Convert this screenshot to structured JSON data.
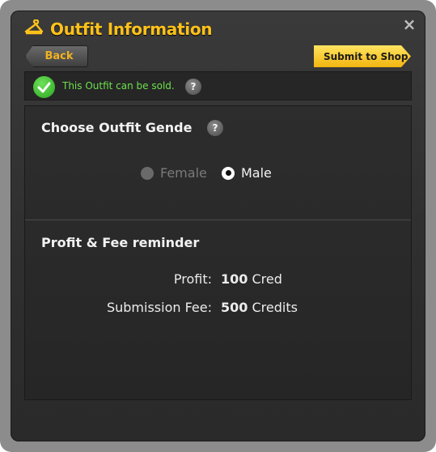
{
  "window": {
    "title": "Outfit Information",
    "close_label": "×"
  },
  "toolbar": {
    "back_label": "Back",
    "submit_label": "Submit to Shop"
  },
  "status": {
    "message": "This Outfit can be sold.",
    "help_label": "?"
  },
  "gender": {
    "title": "Choose Outfit Gende",
    "help_label": "?",
    "options": [
      {
        "label": "Female",
        "selected": false,
        "enabled": false
      },
      {
        "label": "Male",
        "selected": true,
        "enabled": true
      }
    ]
  },
  "fees": {
    "title": "Profit & Fee reminder",
    "profit_label": "Profit:",
    "profit_amount": "100",
    "profit_unit": "Cred",
    "fee_label": "Submission Fee:",
    "fee_amount": "500",
    "fee_unit": "Credits"
  },
  "colors": {
    "accent": "#ffc21a",
    "success": "#6ce04c",
    "submit_button": "#f2b50e"
  },
  "icons": [
    "hanger-icon",
    "close-icon",
    "check-icon",
    "help-icon"
  ]
}
